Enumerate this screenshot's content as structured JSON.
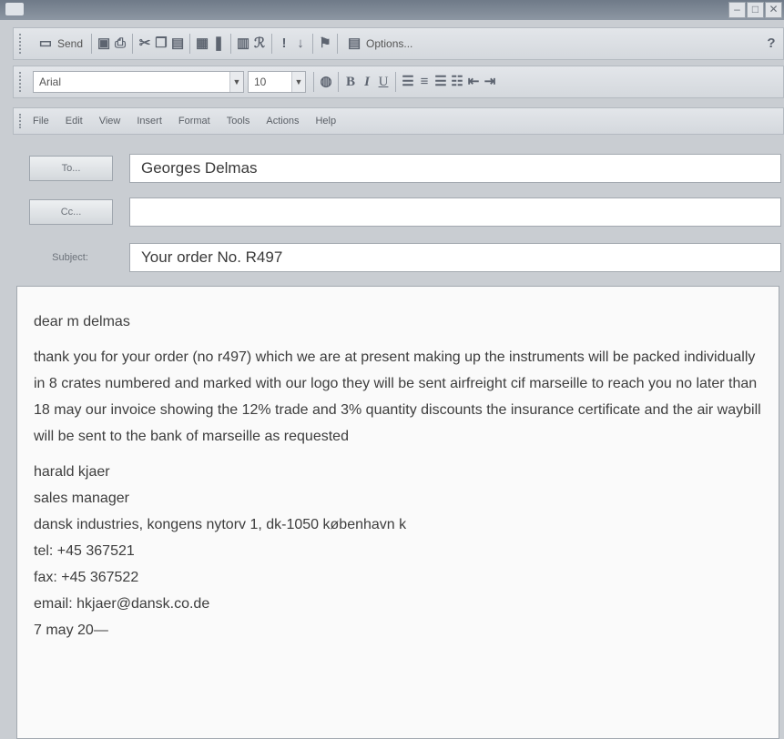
{
  "toolbar1": {
    "send_label": "Send",
    "options_label": "Options..."
  },
  "toolbar2": {
    "font_name": "Arial",
    "font_size": "10",
    "bold": "B",
    "italic": "I",
    "underline": "U"
  },
  "menu": [
    "File",
    "Edit",
    "View",
    "Insert",
    "Format",
    "Tools",
    "Actions",
    "Help"
  ],
  "header": {
    "to_button": "To...",
    "to_value": "Georges Delmas",
    "cc_button": "Cc...",
    "cc_value": "",
    "subject_label": "Subject:",
    "subject_value": "Your order No. R497"
  },
  "message": {
    "greeting": "dear m delmas",
    "body": "thank you for your order (no r497) which we are at present making up the instruments will be packed individually in 8 crates numbered and marked with our logo they will be sent airfreight cif marseille to reach you no later than 18 may our invoice showing the 12% trade and 3% quantity discounts the insurance certificate and the air waybill will be sent to the bank of marseille as requested",
    "signature": [
      "harald kjaer",
      "sales manager",
      "dansk industries, kongens nytorv 1, dk-1050 københavn k",
      "tel: +45 367521",
      "fax: +45 367522",
      "email: hkjaer@dansk.co.de",
      "7 may 20—"
    ]
  }
}
